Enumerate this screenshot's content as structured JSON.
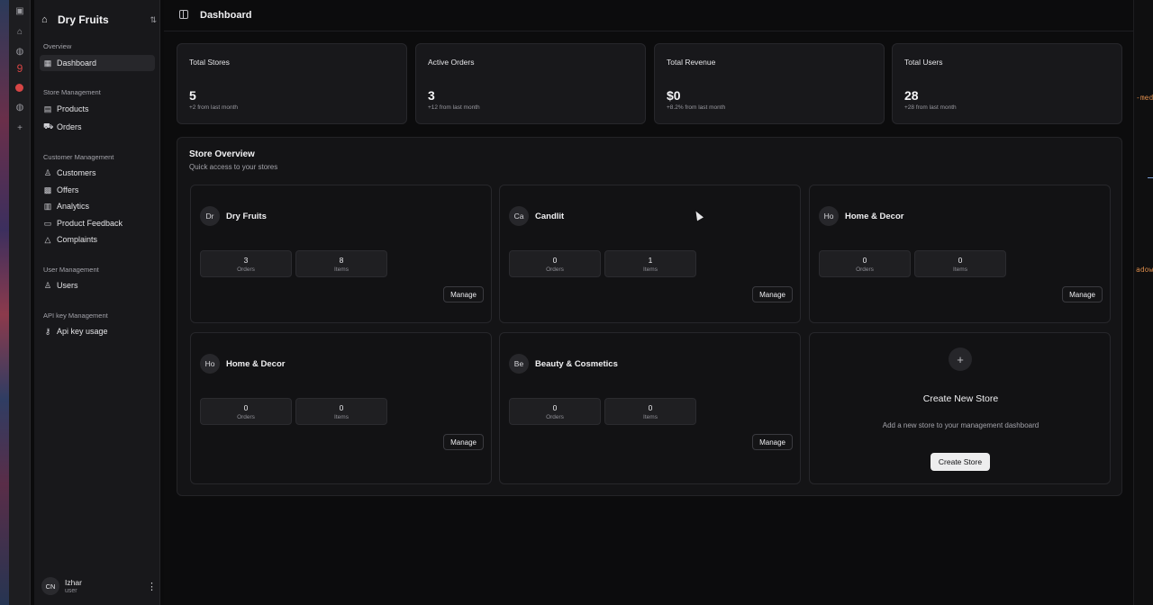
{
  "store_switcher": {
    "name": "Dry Fruits"
  },
  "sidebar": {
    "sections": [
      {
        "title": "Overview",
        "items": [
          {
            "label": "Dashboard",
            "icon": "grid-icon"
          }
        ]
      },
      {
        "title": "Store Management",
        "items": [
          {
            "label": "Products",
            "icon": "box-icon"
          },
          {
            "label": "Orders",
            "icon": "cart-icon"
          }
        ]
      },
      {
        "title": "Customer Management",
        "items": [
          {
            "label": "Customers",
            "icon": "user-icon"
          },
          {
            "label": "Offers",
            "icon": "gift-icon"
          },
          {
            "label": "Analytics",
            "icon": "chart-icon"
          },
          {
            "label": "Product Feedback",
            "icon": "message-icon"
          },
          {
            "label": "Complaints",
            "icon": "warning-icon"
          }
        ]
      },
      {
        "title": "User Management",
        "items": [
          {
            "label": "Users",
            "icon": "users-icon"
          }
        ]
      },
      {
        "title": "API key Management",
        "items": [
          {
            "label": "Api key usage",
            "icon": "key-icon"
          }
        ]
      }
    ],
    "user": {
      "initials": "CN",
      "name": "Izhar",
      "role": "user"
    }
  },
  "header": {
    "title": "Dashboard"
  },
  "stats": [
    {
      "label": "Total Stores",
      "value": "5",
      "sub": "+2 from last month"
    },
    {
      "label": "Active Orders",
      "value": "3",
      "sub": "+12 from last month"
    },
    {
      "label": "Total Revenue",
      "value": "$0",
      "sub": "+8.2% from last month"
    },
    {
      "label": "Total Users",
      "value": "28",
      "sub": "+28 from last month"
    }
  ],
  "overview": {
    "title": "Store Overview",
    "subtitle": "Quick access to your stores",
    "stores": [
      {
        "initials": "Dr",
        "name": "Dry Fruits",
        "orders": "3",
        "items": "8"
      },
      {
        "initials": "Ca",
        "name": "Candlit",
        "orders": "0",
        "items": "1"
      },
      {
        "initials": "Ho",
        "name": "Home & Decor",
        "orders": "0",
        "items": "0"
      },
      {
        "initials": "Ho",
        "name": "Home & Decor",
        "orders": "0",
        "items": "0"
      },
      {
        "initials": "Be",
        "name": "Beauty & Cosmetics",
        "orders": "0",
        "items": "0"
      }
    ],
    "orders_label": "Orders",
    "items_label": "Items",
    "manage_label": "Manage",
    "create": {
      "title": "Create New Store",
      "subtitle": "Add a new store to your management dashboard",
      "button": "Create Store"
    }
  },
  "edge_text": [
    "-med",
    "adow"
  ],
  "colors": {
    "background": "#0c0c0d",
    "panel": "#18181b",
    "accent_button": "#ededee",
    "badge_red": "#d64545"
  }
}
